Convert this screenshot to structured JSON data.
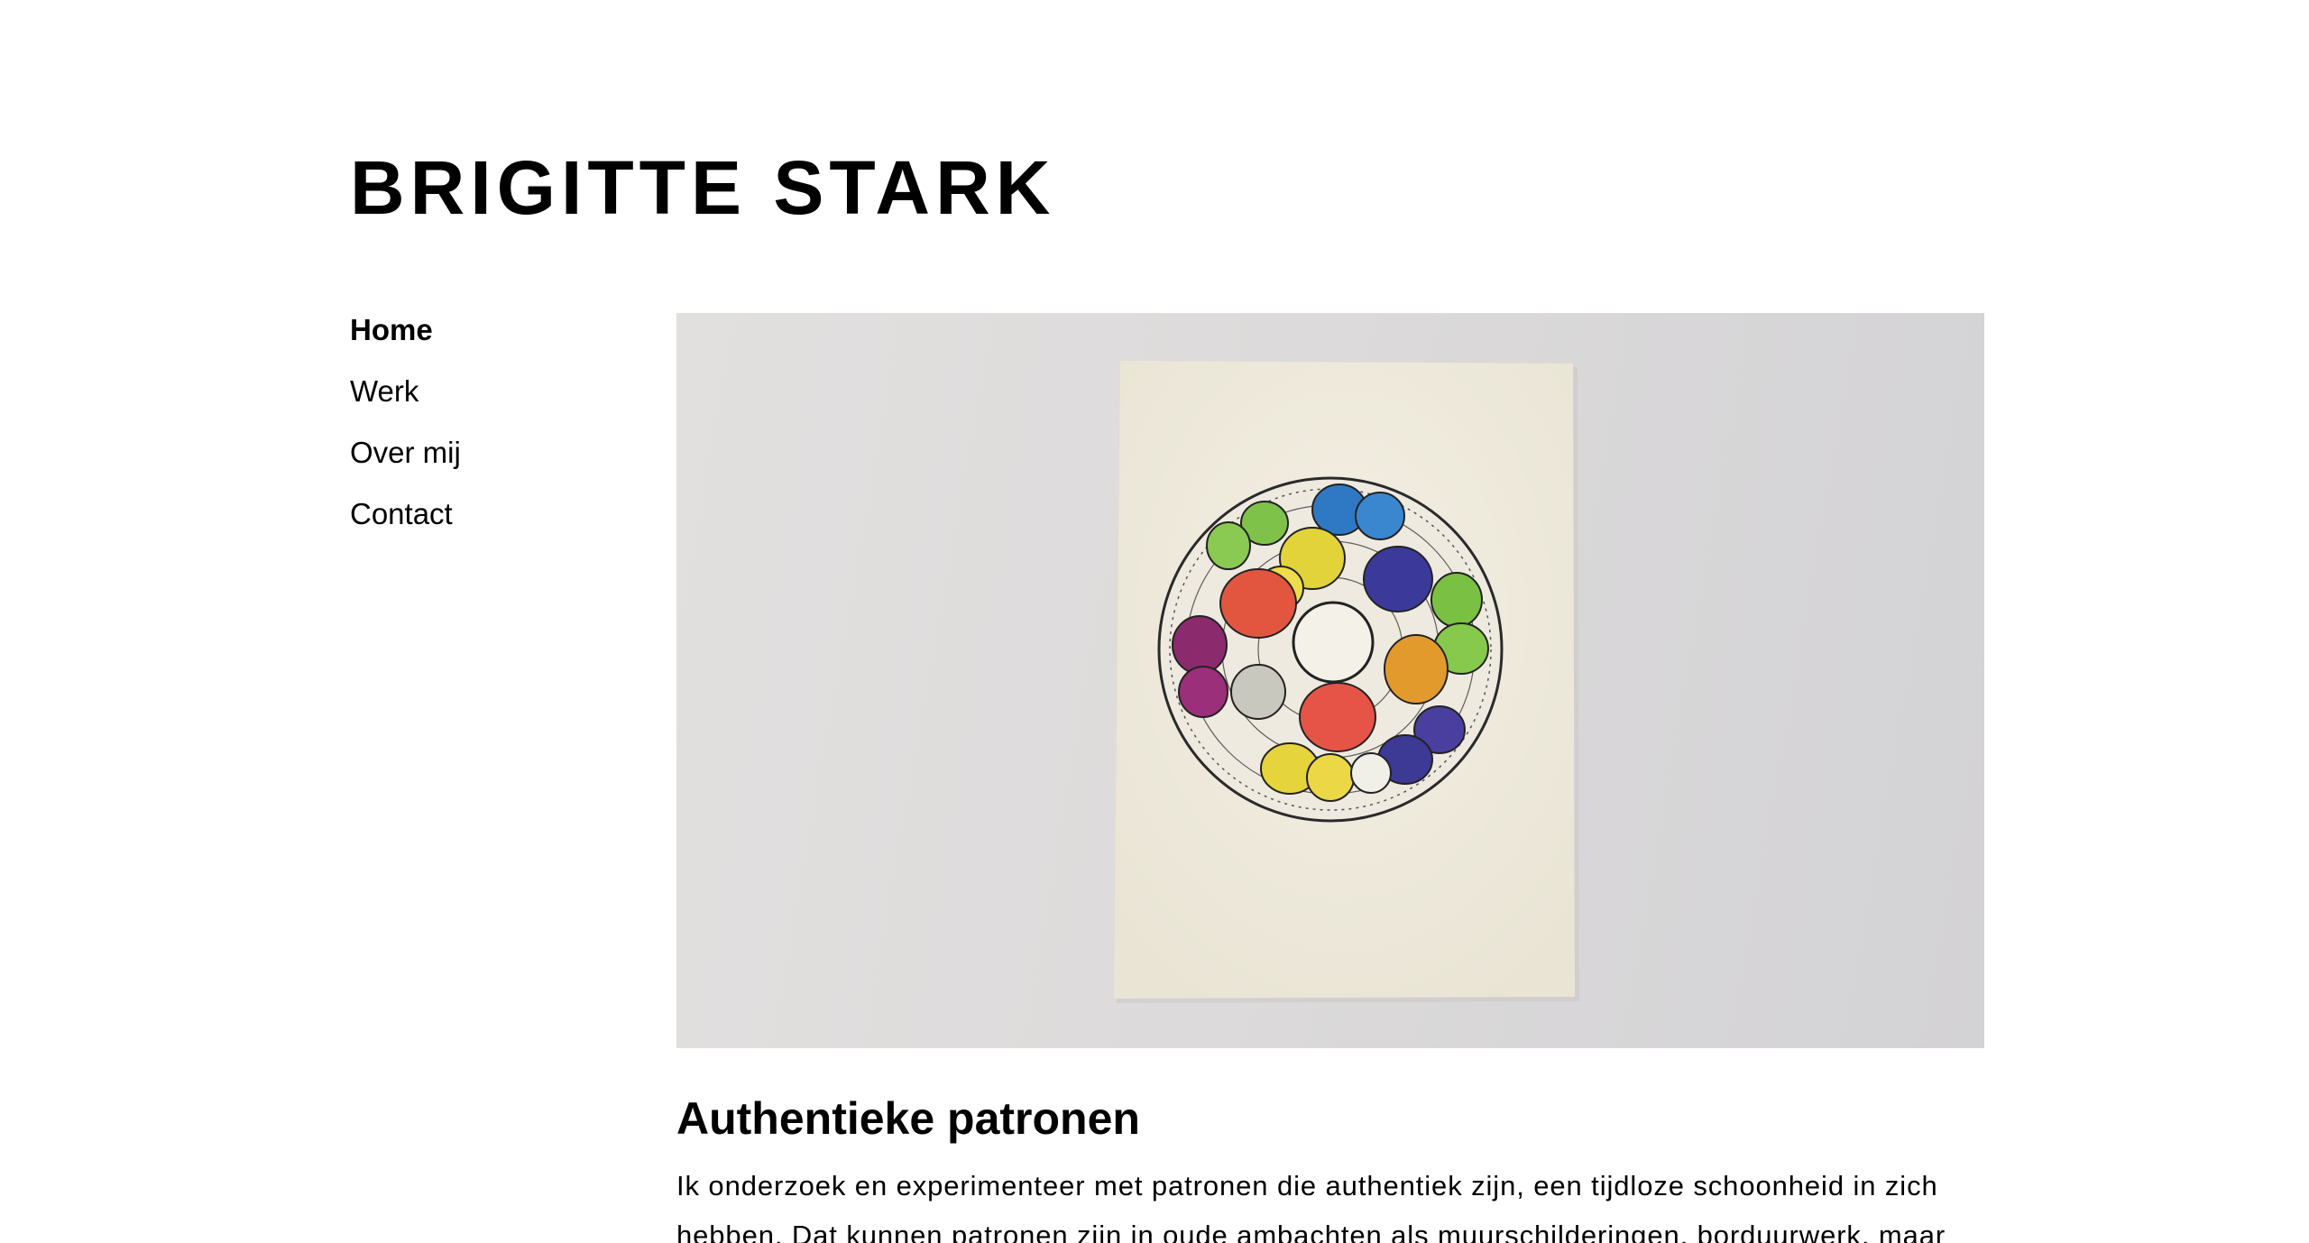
{
  "site": {
    "title": "BRIGITTE STARK"
  },
  "nav": {
    "items": [
      {
        "label": "Home",
        "active": true
      },
      {
        "label": "Werk",
        "active": false
      },
      {
        "label": "Over mij",
        "active": false
      },
      {
        "label": "Contact",
        "active": false
      }
    ]
  },
  "hero": {
    "image_subject": "hand-drawn circular mandala with colored blobs on paper"
  },
  "content": {
    "heading": "Authentieke patronen",
    "paragraph": "Ik onderzoek en experimenteer met patronen die authentiek zijn, een tijdloze schoonheid in zich hebben. Dat kunnen patronen zijn in oude ambachten als muurschilderingen, borduurwerk, maar"
  },
  "colors": {
    "text": "#000000",
    "background": "#ffffff",
    "photo_backdrop": "#dcdada",
    "paper": "#f1ede0"
  }
}
